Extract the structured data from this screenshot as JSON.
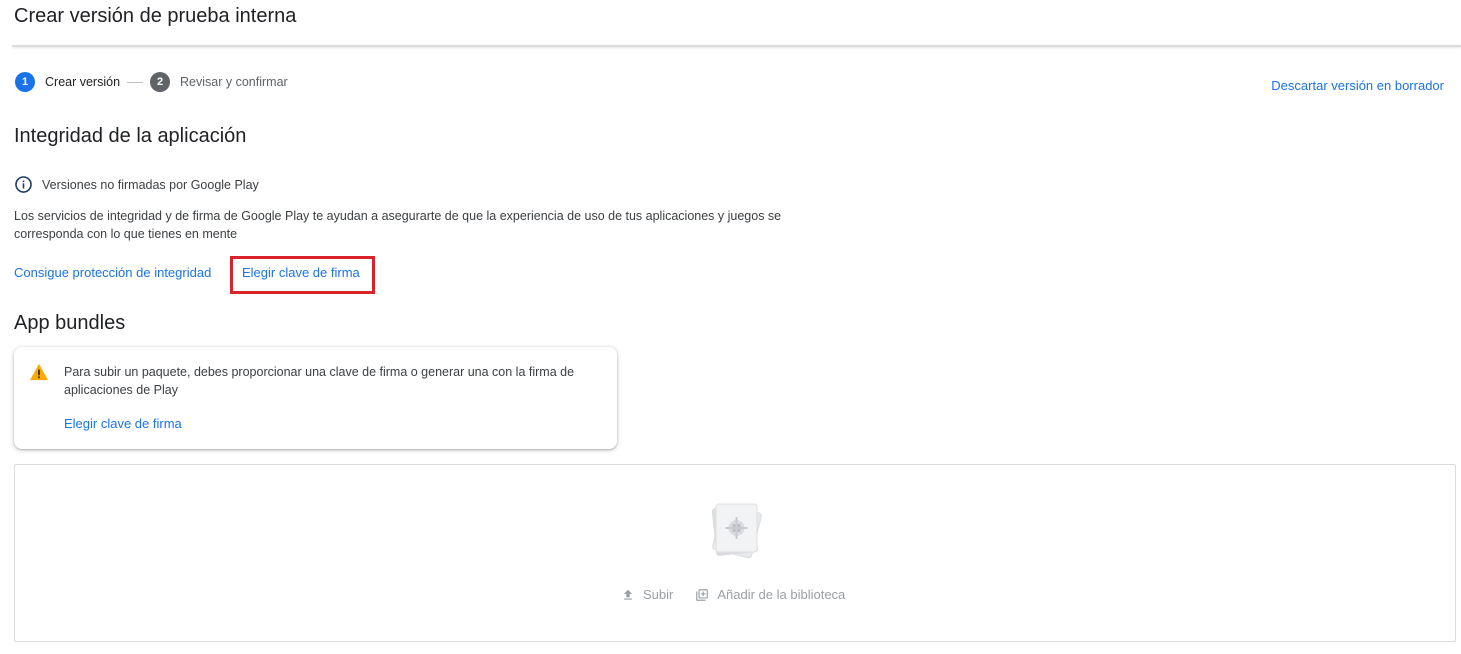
{
  "header": {
    "title": "Crear versión de prueba interna"
  },
  "stepper": {
    "steps": [
      {
        "num": "1",
        "label": "Crear versión",
        "state": "active"
      },
      {
        "num": "2",
        "label": "Revisar y confirmar",
        "state": "inactive"
      }
    ]
  },
  "discard_link": "Descartar versión en borrador",
  "integrity": {
    "heading": "Integridad de la aplicación",
    "status_text": "Versiones no firmadas por Google Play",
    "description": "Los servicios de integridad y de firma de Google Play te ayudan a asegurarte de que la experiencia de uso de tus aplicaciones y juegos se corresponda con lo que tienes en mente",
    "link_protection": "Consigue protección de integridad",
    "link_signing_key": "Elegir clave de firma"
  },
  "bundles": {
    "heading": "App bundles",
    "warning_text": "Para subir un paquete, debes proporcionar una clave de firma o generar una con la firma de aplicaciones de Play",
    "warning_link": "Elegir clave de firma",
    "upload_label": "Subir",
    "library_label": "Añadir de la biblioteca"
  },
  "icons": {
    "info": "info-icon",
    "warning": "warning-icon",
    "upload": "upload-icon",
    "library": "add-library-icon",
    "bundle": "app-bundle-placeholder-icon"
  },
  "colors": {
    "accent": "#1a73e8",
    "highlight": "#d9232a",
    "warning": "#f9ab00",
    "disabled": "#9aa0a6"
  }
}
